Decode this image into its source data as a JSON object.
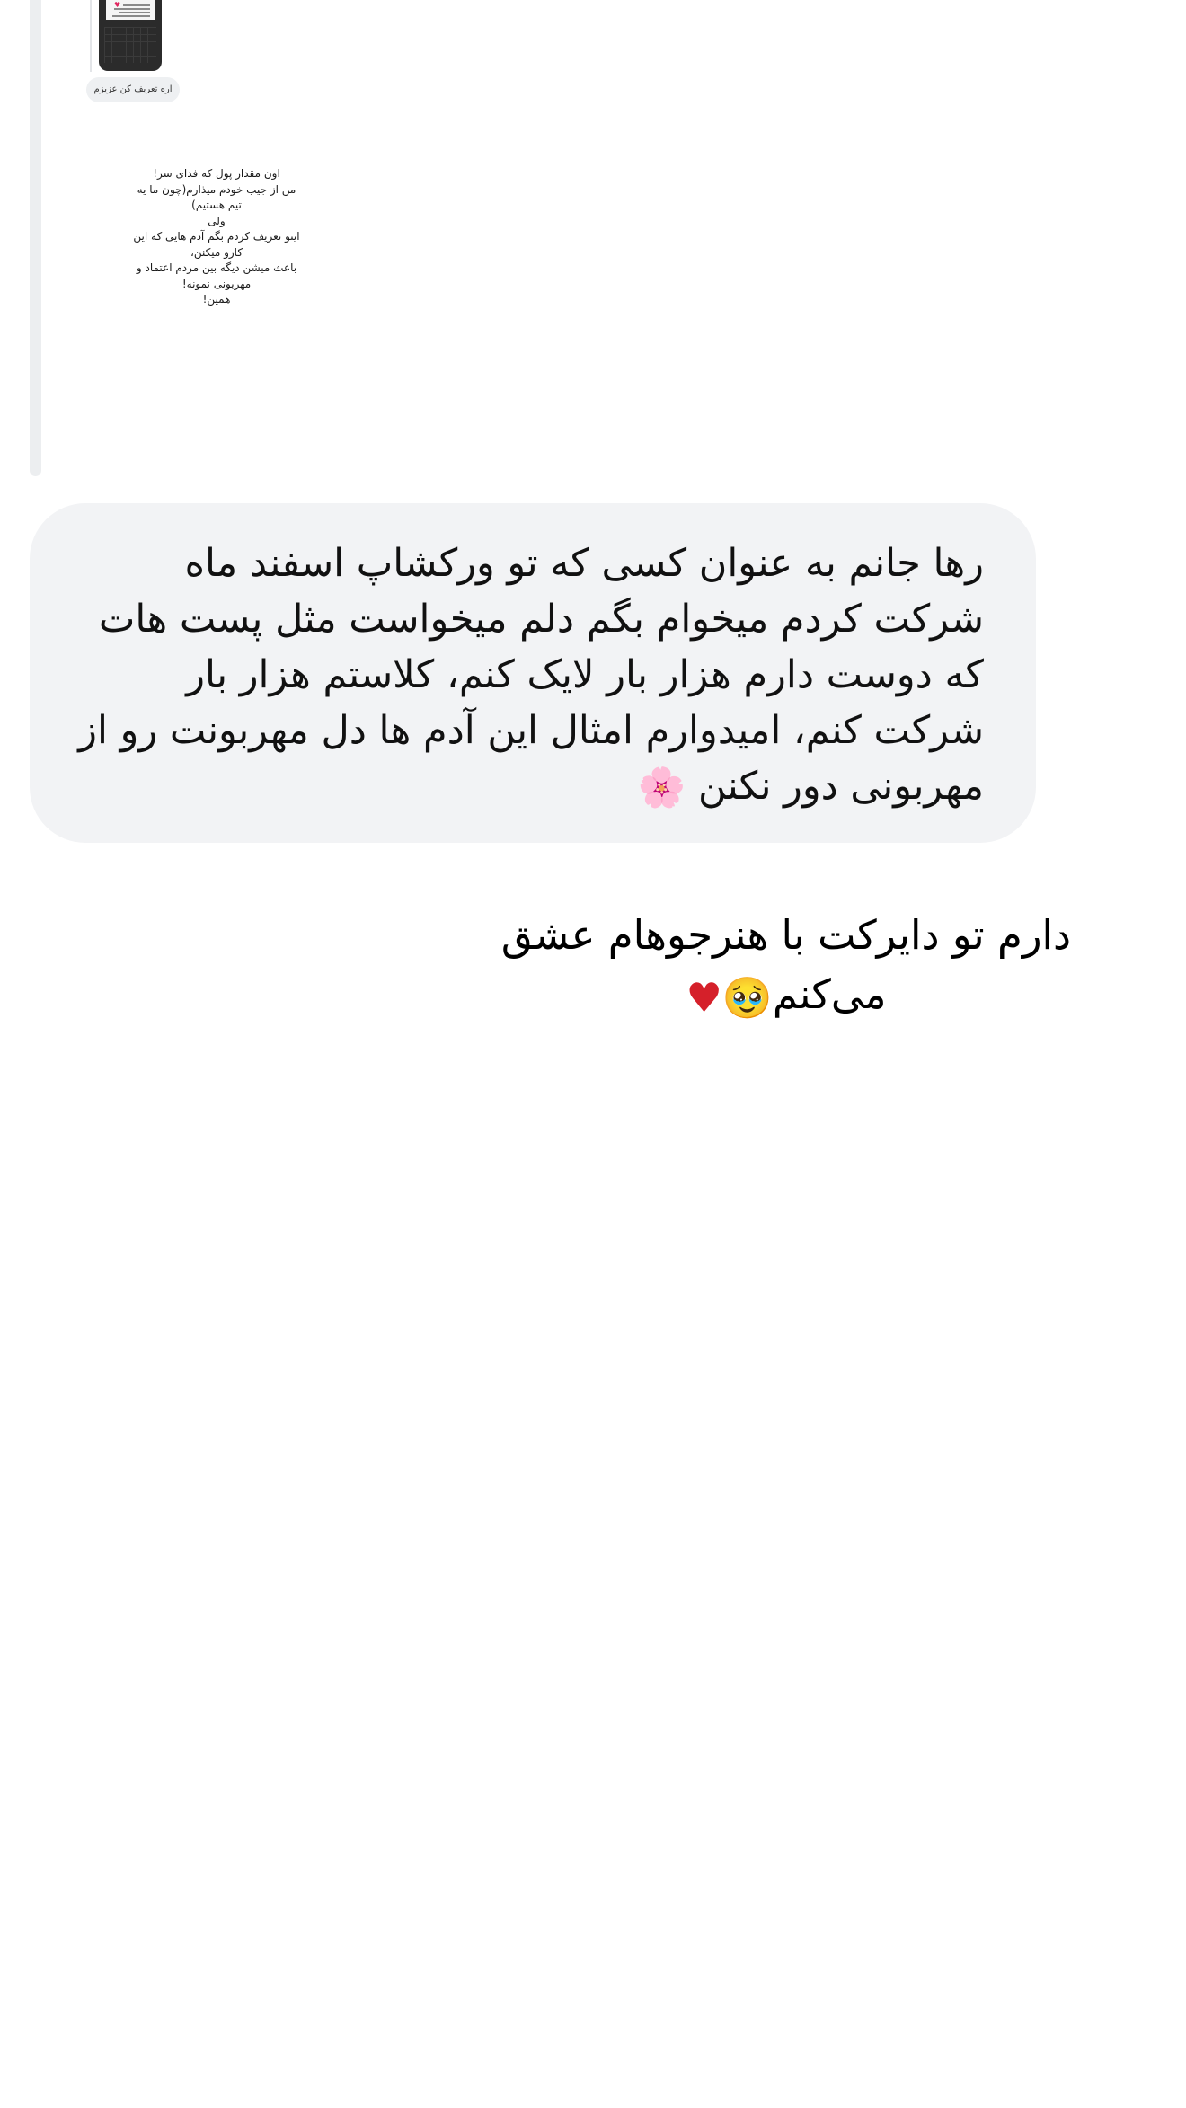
{
  "shared_story": {
    "caption": "اره تعریف کن عزیزم",
    "text": "اون مقدار پول که فدای سر!\nمن از جیب خودم میذارم(چون ما یه\nتیم هستیم)\nولی\nاینو تعریف کردم بگم آدم هایی که این\nکارو میکنن،\nباعث میشن دیگه بین مردم اعتماد و\nمهربونی نمونه!\nهمین!"
  },
  "message": {
    "text": "رها جانم به عنوان کسی که تو ورکشاپ اسفند ماه شرکت کردم میخوام بگم دلم میخواست مثل پست هات که دوست دارم هزار بار لایک کنم، کلاستم هزار بار شرکت کنم، امیدوارم امثال این آدم ها دل مهربونت رو از مهربونی دور نکنن",
    "emoji": "🌸"
  },
  "overlay_text": {
    "line1": "دارم تو دایرکت با هنرجوهام عشق",
    "line2": "می‌کنم",
    "emoji_face": "🥹",
    "emoji_heart": "♥"
  },
  "colors": {
    "bubble_background": "#f2f3f5",
    "heart": "#d5202a"
  }
}
